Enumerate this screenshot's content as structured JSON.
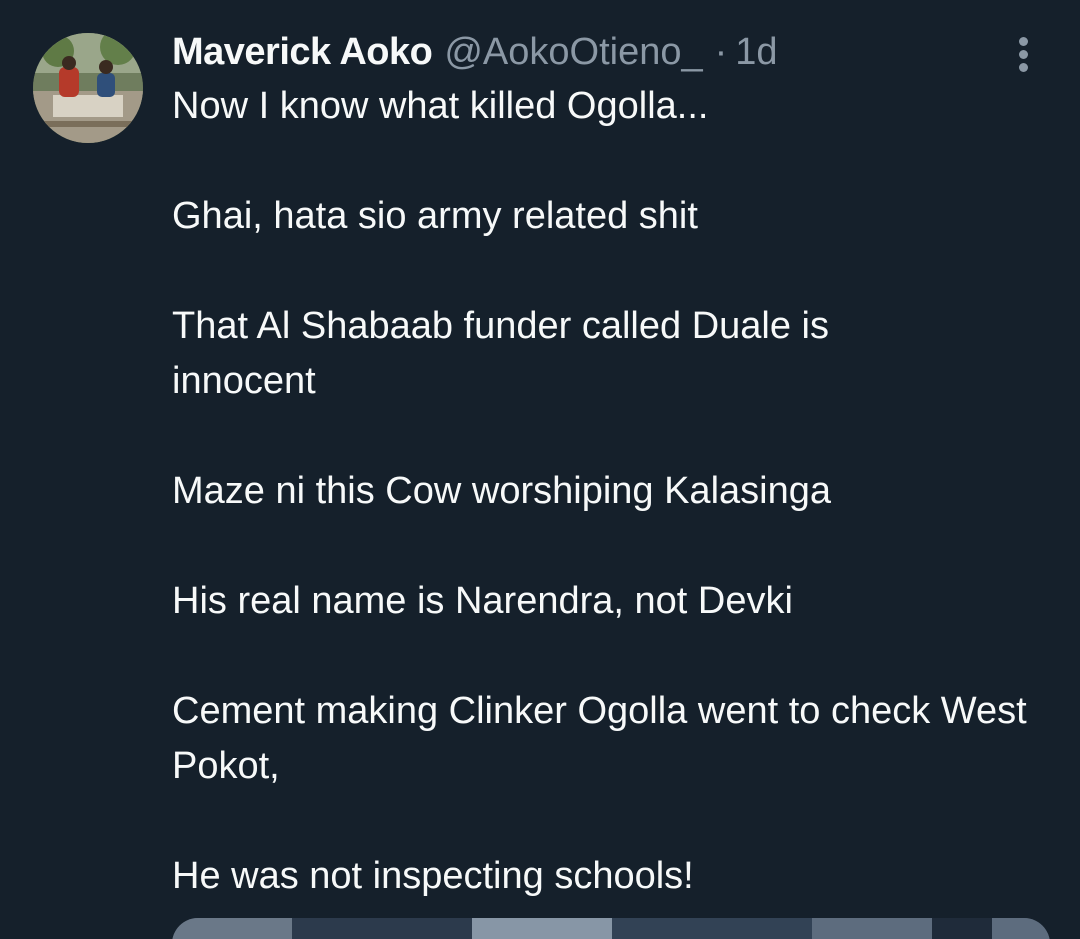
{
  "tweet": {
    "author": {
      "display_name": "Maverick Aoko",
      "handle": "@AokoOtieno_",
      "separator": "·",
      "time": "1d",
      "avatar_icon": "profile-photo"
    },
    "more_icon": "more-vertical-icon",
    "paragraphs": [
      "Now I know what killed Ogolla...",
      "Ghai, hata sio army related shit",
      "That Al Shabaab funder called Duale is innocent",
      "Maze ni this Cow worshiping Kalasinga",
      "His real name is Narendra, not Devki",
      "Cement making Clinker Ogolla went to check West Pokot,",
      "He was not inspecting schools!"
    ],
    "media": {
      "type": "image-preview"
    }
  },
  "colors": {
    "background": "#15202b",
    "primary_text": "#f7f9f9",
    "secondary_text": "#8b98a5"
  }
}
